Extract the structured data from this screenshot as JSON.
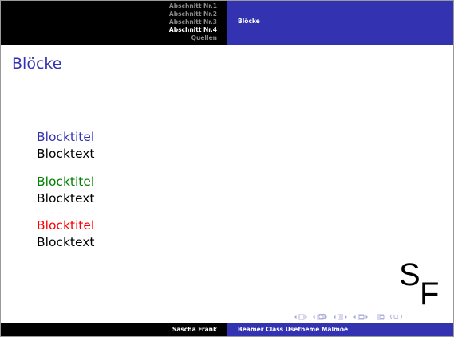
{
  "header": {
    "sections": [
      {
        "label": "Abschnitt Nr.1",
        "active": false
      },
      {
        "label": "Abschnitt Nr.2",
        "active": false
      },
      {
        "label": "Abschnitt Nr.3",
        "active": false
      },
      {
        "label": "Abschnitt Nr.4",
        "active": true
      },
      {
        "label": "Quellen",
        "active": false
      }
    ],
    "subsection": "Blöcke"
  },
  "frame": {
    "title": "Blöcke"
  },
  "blocks": [
    {
      "title": "Blocktitel",
      "text": "Blocktext",
      "title_color": "#3333b2",
      "kind": "block"
    },
    {
      "title": "Blocktitel",
      "text": "Blocktext",
      "title_color": "#008000",
      "kind": "exampleblock"
    },
    {
      "title": "Blocktitel",
      "text": "Blocktext",
      "title_color": "#ff0000",
      "kind": "alertblock"
    }
  ],
  "logo": {
    "letter_1": "S",
    "letter_2": "F"
  },
  "footer": {
    "author": "Sascha Frank",
    "title": "Beamer Class Usetheme Malmoe"
  },
  "colors": {
    "structure": "#3333b2",
    "header_left_bg": "#000000",
    "inactive_section": "#8a8a8a",
    "nav_symbols": "#a8a8d8"
  },
  "navigation": {
    "icons": [
      "nav-slide-icon",
      "nav-frame-icon",
      "nav-subsection-icon",
      "nav-section-icon",
      "nav-document-icon",
      "nav-search-icon"
    ]
  }
}
